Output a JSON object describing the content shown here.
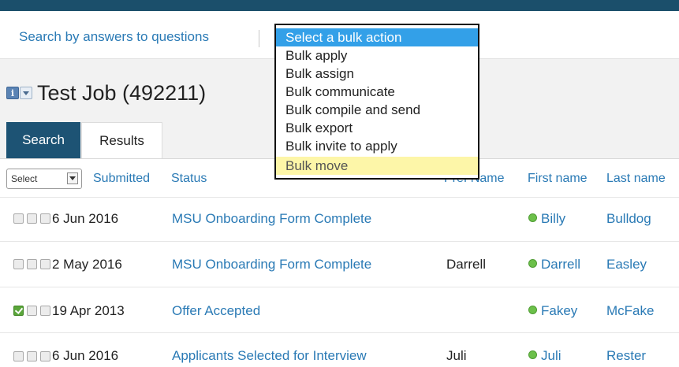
{
  "toolbar": {
    "search_link": "Search by answers to questions"
  },
  "bulk_menu": {
    "items": [
      "Select a bulk action",
      "Bulk apply",
      "Bulk assign",
      "Bulk communicate",
      "Bulk compile and send",
      "Bulk export",
      "Bulk invite to apply",
      "Bulk move"
    ],
    "selected_index": 0,
    "highlighted_index": 7
  },
  "job": {
    "title": "Test Job (492211)",
    "info_icon": "i"
  },
  "tabs": {
    "search": "Search",
    "results": "Results"
  },
  "table": {
    "select_label": "Select",
    "headers": {
      "submitted": "Submitted",
      "status": "Status",
      "pref_name": "Pref Name",
      "first_name": "First name",
      "last_name": "Last name"
    },
    "rows": [
      {
        "checked": false,
        "date": "6 Jun 2016",
        "status": "MSU Onboarding Form Complete",
        "pref_name": "",
        "first_name": "Billy",
        "last_name": "Bulldog"
      },
      {
        "checked": false,
        "date": "2 May 2016",
        "status": "MSU Onboarding Form Complete",
        "pref_name": "Darrell",
        "first_name": "Darrell",
        "last_name": "Easley"
      },
      {
        "checked": true,
        "date": "19 Apr 2013",
        "status": "Offer Accepted",
        "pref_name": "",
        "first_name": "Fakey",
        "last_name": "McFake"
      },
      {
        "checked": false,
        "date": "6 Jun 2016",
        "status": "Applicants Selected for Interview",
        "pref_name": "Juli",
        "first_name": "Juli",
        "last_name": "Rester"
      }
    ]
  },
  "colors": {
    "topbar": "#1b4f6b",
    "link": "#2a7ab5",
    "tab_active": "#1d5374",
    "menu_selected": "#33a0e8",
    "menu_highlight": "#fdf6a8",
    "status_dot": "#6cc04a"
  }
}
